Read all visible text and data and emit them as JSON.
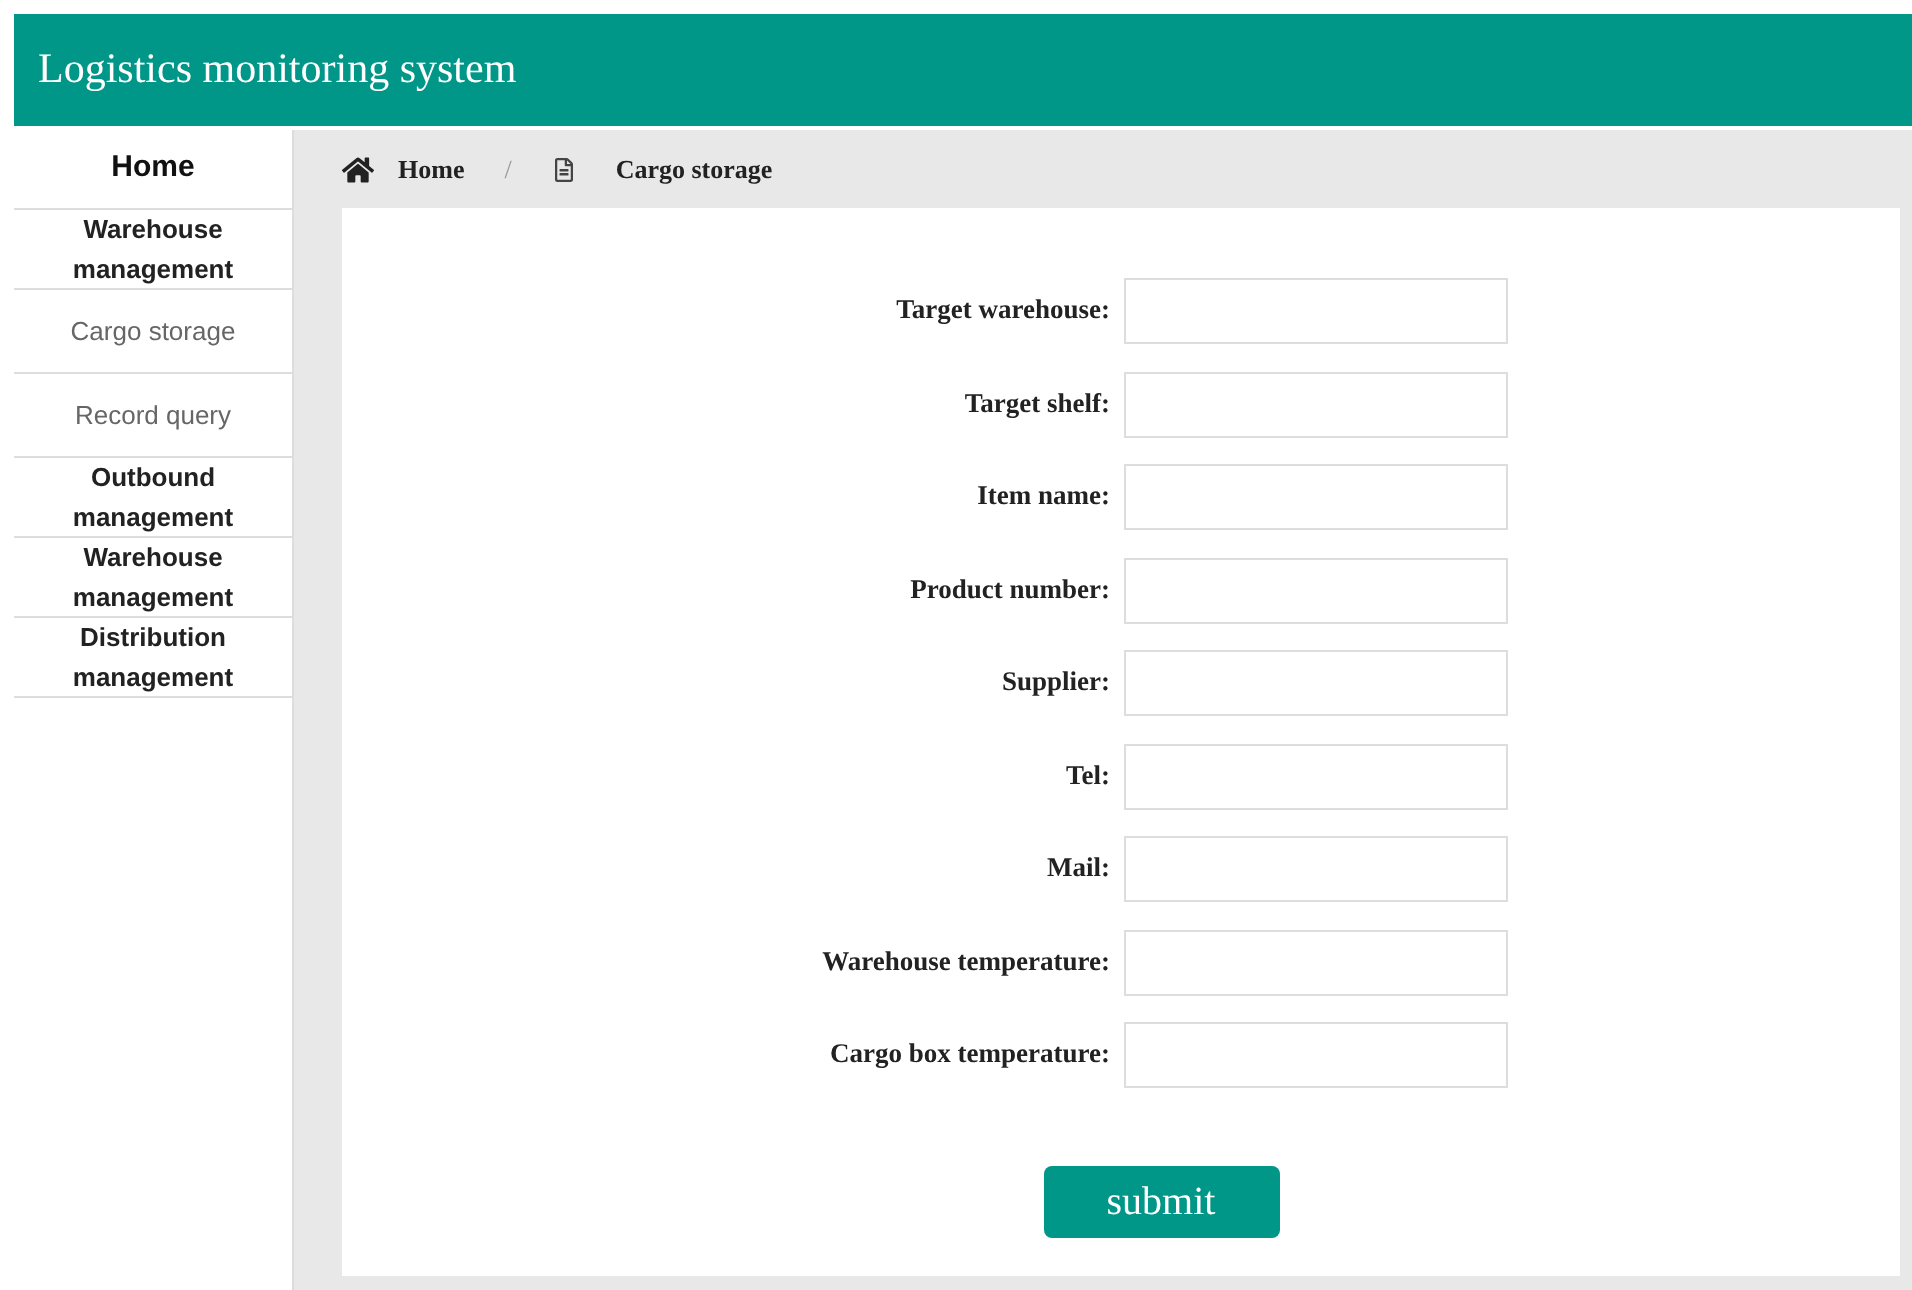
{
  "header": {
    "title": "Logistics monitoring system"
  },
  "sidebar": {
    "items": [
      {
        "label": "Home",
        "kind": "home"
      },
      {
        "label": "Warehouse management",
        "kind": "group"
      },
      {
        "label": "Cargo storage",
        "kind": "sub"
      },
      {
        "label": "Record query",
        "kind": "sub"
      },
      {
        "label": "Outbound management",
        "kind": "group"
      },
      {
        "label": "Warehouse management",
        "kind": "group"
      },
      {
        "label": "Distribution management",
        "kind": "group"
      }
    ]
  },
  "breadcrumb": [
    {
      "label": "Home",
      "kind": "home"
    },
    {
      "label": "Cargo storage",
      "kind": "page"
    }
  ],
  "breadcrumb_separator": "/",
  "form": {
    "fields": [
      {
        "label": "Target warehouse:"
      },
      {
        "label": "Target shelf:"
      },
      {
        "label": "Item name:"
      },
      {
        "label": "Product number:"
      },
      {
        "label": "Supplier:"
      },
      {
        "label": "Tel:"
      },
      {
        "label": "Mail:"
      },
      {
        "label": "Warehouse temperature:"
      },
      {
        "label": "Cargo box temperature:"
      }
    ],
    "submit": "submit"
  }
}
